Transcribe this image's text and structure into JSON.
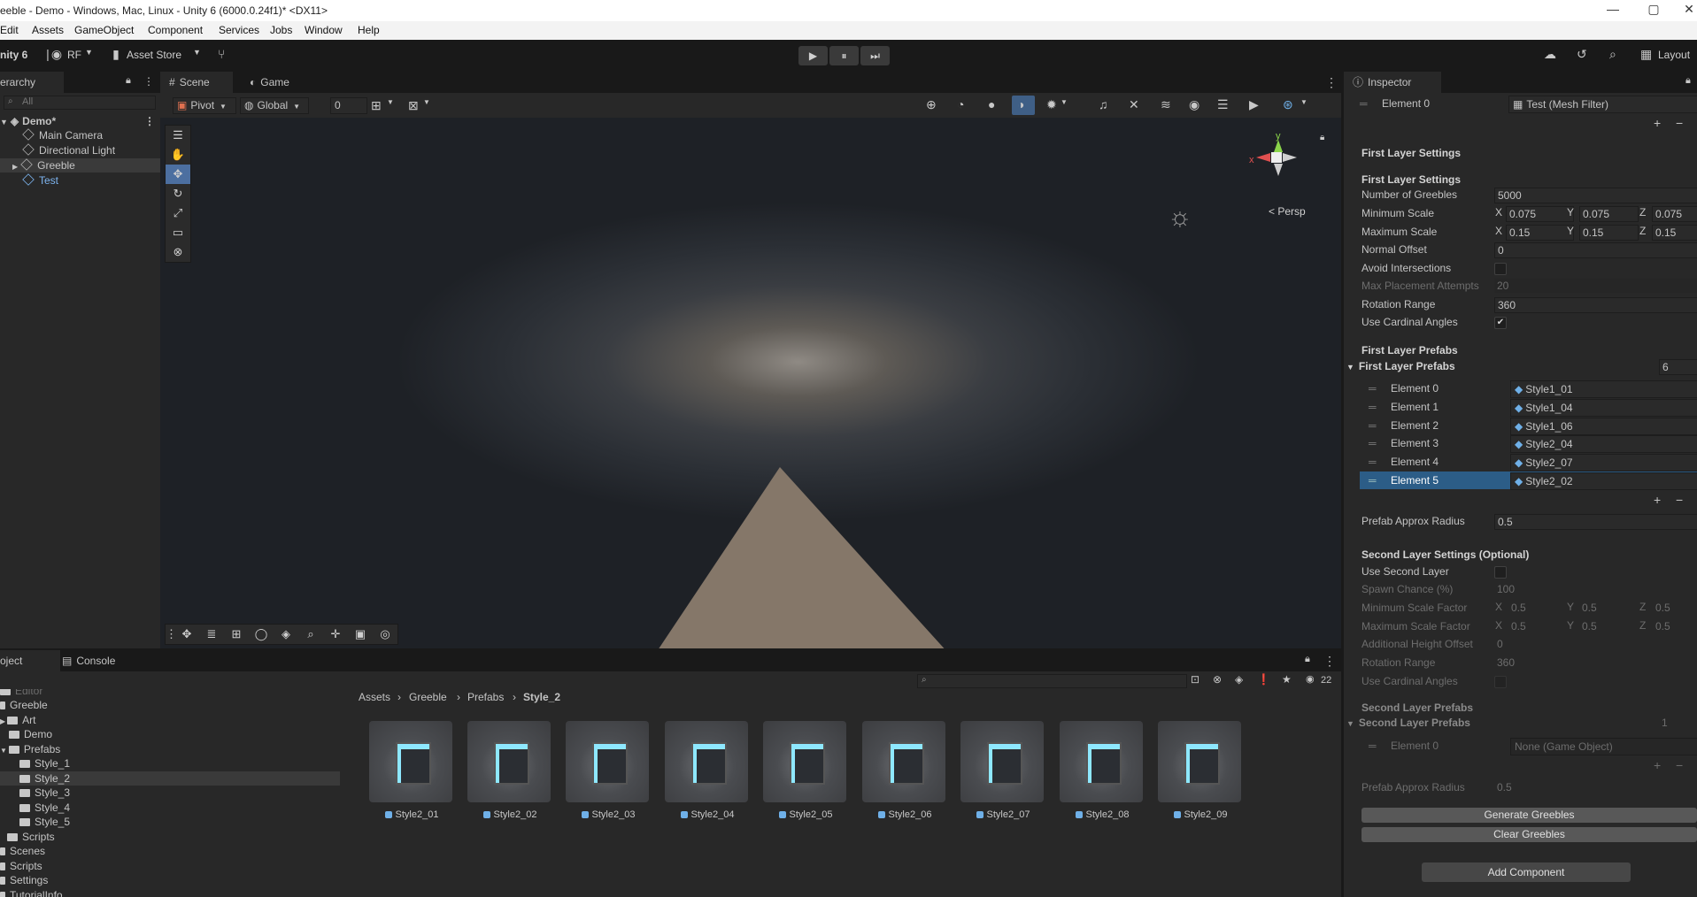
{
  "window": {
    "title": "eeble - Demo - Windows, Mac, Linux - Unity 6 (6000.0.24f1)* <DX11>",
    "controls": {
      "minimize": "—",
      "maximize": "▢",
      "close": "✕"
    }
  },
  "menu": [
    "Edit",
    "Assets",
    "GameObject",
    "Component",
    "Services",
    "Jobs",
    "Window",
    "Help"
  ],
  "toolbar": {
    "unity_label": "nity 6",
    "account": "RF",
    "asset_store": "Asset Store",
    "layout": "Layout",
    "play": "▶",
    "pause": "⏸",
    "step": "⏭"
  },
  "hierarchy": {
    "tab": "erarchy",
    "search_placeholder": "All",
    "scene_name": "Demo*",
    "items": [
      {
        "label": "Main Camera"
      },
      {
        "label": "Directional Light"
      },
      {
        "label": "Greeble"
      },
      {
        "label": "Test"
      }
    ]
  },
  "scene_view": {
    "tabs": [
      {
        "label": "Scene"
      },
      {
        "label": "Game"
      }
    ],
    "pivot": "Pivot",
    "global": "Global",
    "snap_value": "0",
    "gizmo_y": "y",
    "gizmo_x": "x",
    "persp": "< Persp"
  },
  "inspector": {
    "tab": "Inspector",
    "top_element": {
      "label": "Element 0",
      "value": "Test (Mesh Filter)"
    },
    "first_layer_settings_title": "First Layer Settings",
    "first_layer_settings_sub": "First Layer Settings",
    "fields": {
      "number_of_greebles": {
        "label": "Number of Greebles",
        "value": "5000"
      },
      "minimum_scale": {
        "label": "Minimum Scale",
        "x": "0.075",
        "y": "0.075",
        "z": "0.075"
      },
      "maximum_scale": {
        "label": "Maximum Scale",
        "x": "0.15",
        "y": "0.15",
        "z": "0.15"
      },
      "normal_offset": {
        "label": "Normal Offset",
        "value": "0"
      },
      "avoid_intersections": {
        "label": "Avoid Intersections",
        "checked": false
      },
      "max_placement_attempts": {
        "label": "Max Placement Attempts",
        "value": "20"
      },
      "rotation_range": {
        "label": "Rotation Range",
        "value": "360"
      },
      "use_cardinal_angles": {
        "label": "Use Cardinal Angles",
        "checked": true
      }
    },
    "first_layer_prefabs_title": "First Layer Prefabs",
    "first_layer_prefabs_list": {
      "label": "First Layer Prefabs",
      "count": "6"
    },
    "first_prefabs": [
      {
        "label": "Element 0",
        "value": "Style1_01"
      },
      {
        "label": "Element 1",
        "value": "Style1_04"
      },
      {
        "label": "Element 2",
        "value": "Style1_06"
      },
      {
        "label": "Element 3",
        "value": "Style2_04"
      },
      {
        "label": "Element 4",
        "value": "Style2_07"
      },
      {
        "label": "Element 5",
        "value": "Style2_02"
      }
    ],
    "prefab_approx_radius": {
      "label": "Prefab Approx Radius",
      "value": "0.5"
    },
    "second_layer_title": "Second Layer Settings (Optional)",
    "second": {
      "use_second_layer": {
        "label": "Use Second Layer",
        "checked": false
      },
      "spawn_chance": {
        "label": "Spawn Chance (%)",
        "value": "100"
      },
      "min_scale_factor": {
        "label": "Minimum Scale Factor",
        "x": "0.5",
        "y": "0.5",
        "z": "0.5"
      },
      "max_scale_factor": {
        "label": "Maximum Scale Factor",
        "x": "0.5",
        "y": "0.5",
        "z": "0.5"
      },
      "additional_height_offset": {
        "label": "Additional Height Offset",
        "value": "0"
      },
      "rotation_range": {
        "label": "Rotation Range",
        "value": "360"
      },
      "use_cardinal_angles": {
        "label": "Use Cardinal Angles",
        "checked": false
      }
    },
    "second_prefabs_title": "Second Layer Prefabs",
    "second_prefabs_list": {
      "label": "Second Layer Prefabs",
      "count": "1"
    },
    "second_element": {
      "label": "Element 0",
      "value": "None (Game Object)"
    },
    "second_prefab_radius": {
      "label": "Prefab Approx Radius",
      "value": "0.5"
    },
    "generate_button": "Generate Greebles",
    "clear_button": "Clear Greebles",
    "add_component": "Add Component",
    "axis": {
      "x": "X",
      "y": "Y",
      "z": "Z"
    },
    "plus": "+",
    "minus": "−"
  },
  "project": {
    "tabs": [
      {
        "label": "oject"
      },
      {
        "label": "Console"
      }
    ],
    "hidden_count": "22",
    "breadcrumb": [
      "Assets",
      "Greeble",
      "Prefabs",
      "Style_2"
    ],
    "tree": [
      {
        "label": "Editor"
      },
      {
        "label": "Greeble"
      },
      {
        "label": "Art"
      },
      {
        "label": "Demo"
      },
      {
        "label": "Prefabs"
      },
      {
        "label": "Style_1"
      },
      {
        "label": "Style_2"
      },
      {
        "label": "Style_3"
      },
      {
        "label": "Style_4"
      },
      {
        "label": "Style_5"
      },
      {
        "label": "Scripts"
      },
      {
        "label": "Scenes"
      },
      {
        "label": "Scripts"
      },
      {
        "label": "Settings"
      },
      {
        "label": "TutorialInfo"
      }
    ],
    "assets": [
      {
        "label": "Style2_01"
      },
      {
        "label": "Style2_02"
      },
      {
        "label": "Style2_03"
      },
      {
        "label": "Style2_04"
      },
      {
        "label": "Style2_05"
      },
      {
        "label": "Style2_06"
      },
      {
        "label": "Style2_07"
      },
      {
        "label": "Style2_08"
      },
      {
        "label": "Style2_09"
      }
    ]
  }
}
